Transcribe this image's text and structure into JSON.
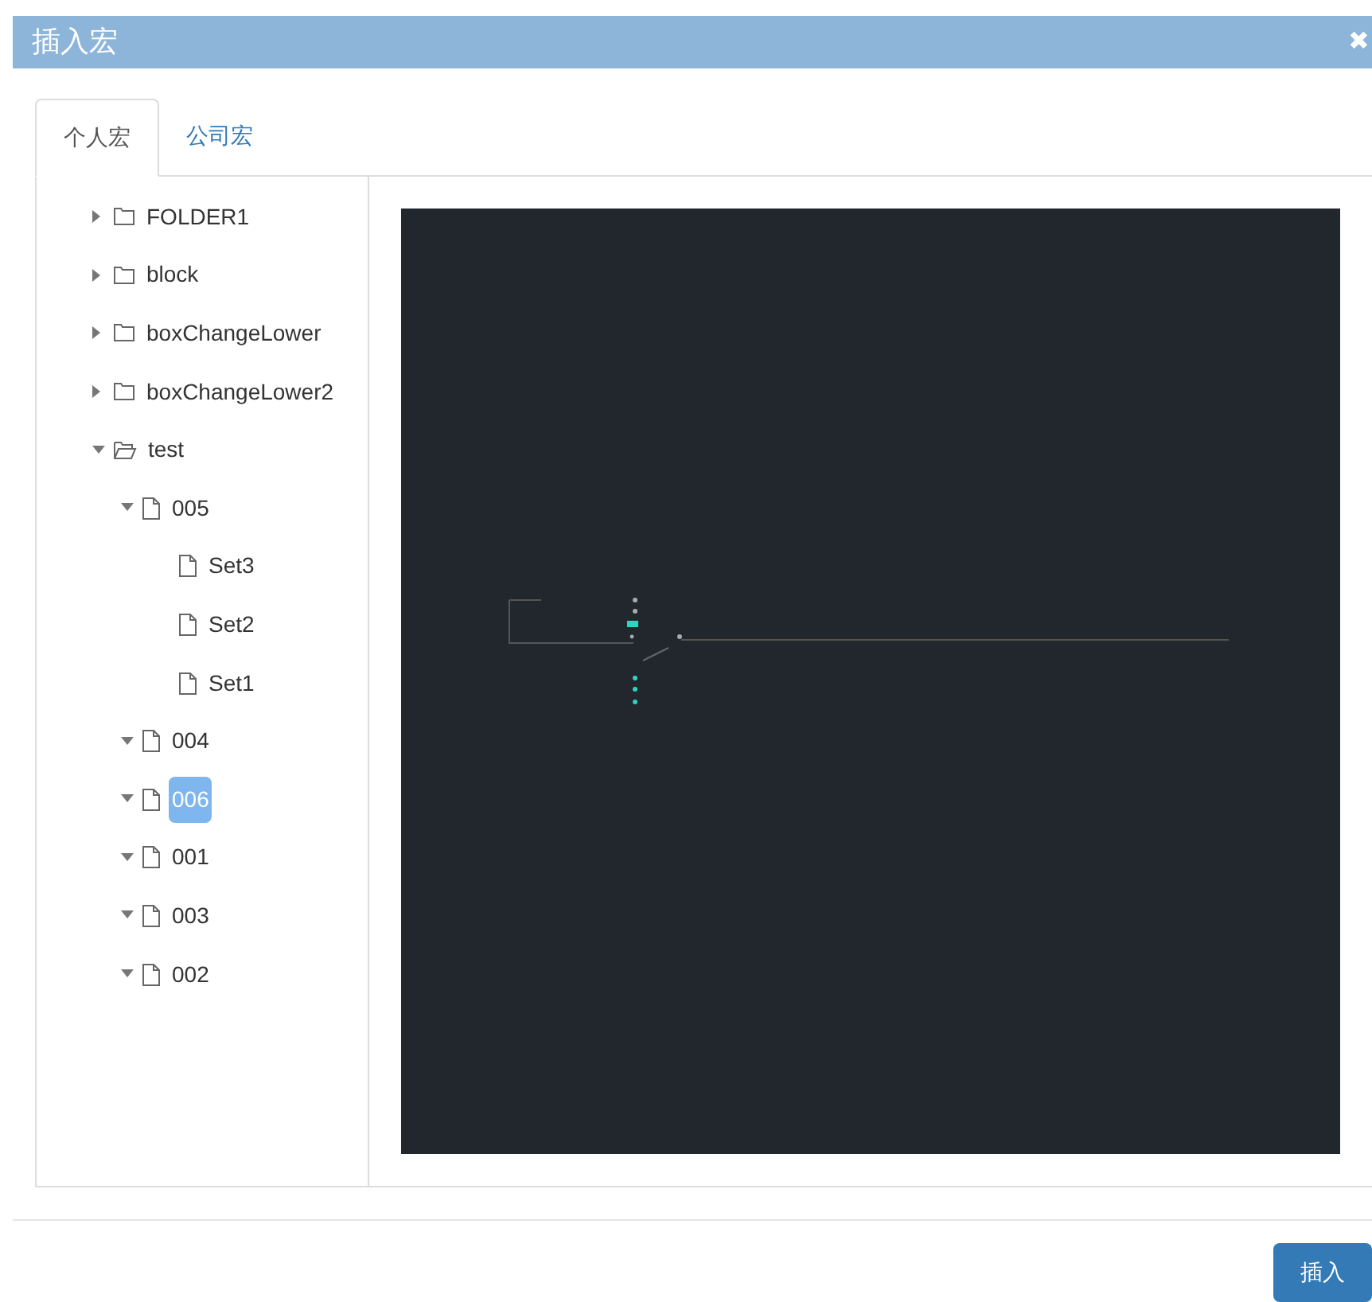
{
  "window": {
    "title": "插入宏",
    "close": "✖"
  },
  "tabs": [
    {
      "label": "个人宏",
      "selected": true
    },
    {
      "label": "公司宏",
      "selected": false
    }
  ],
  "tree": [
    {
      "label": "FOLDER1",
      "kind": "folder",
      "expanded": false,
      "selected": false
    },
    {
      "label": "block",
      "kind": "folder",
      "expanded": false,
      "selected": false
    },
    {
      "label": "boxChangeLower",
      "kind": "folder",
      "expanded": false,
      "selected": false
    },
    {
      "label": "boxChangeLower2",
      "kind": "folder",
      "expanded": false,
      "selected": false
    },
    {
      "label": "test",
      "kind": "folder",
      "expanded": true,
      "selected": false,
      "children": [
        {
          "label": "005",
          "kind": "file",
          "expanded": true,
          "selected": false,
          "children": [
            {
              "label": "Set3",
              "kind": "file",
              "selected": false
            },
            {
              "label": "Set2",
              "kind": "file",
              "selected": false
            },
            {
              "label": "Set1",
              "kind": "file",
              "selected": false
            }
          ]
        },
        {
          "label": "004",
          "kind": "file",
          "expanded": true,
          "selected": false
        },
        {
          "label": "006",
          "kind": "file",
          "expanded": true,
          "selected": true
        },
        {
          "label": "001",
          "kind": "file",
          "expanded": true,
          "selected": false
        },
        {
          "label": "003",
          "kind": "file",
          "expanded": true,
          "selected": false
        },
        {
          "label": "002",
          "kind": "file",
          "expanded": true,
          "selected": false
        }
      ]
    }
  ],
  "buttons": [
    {
      "label": "插入"
    }
  ]
}
